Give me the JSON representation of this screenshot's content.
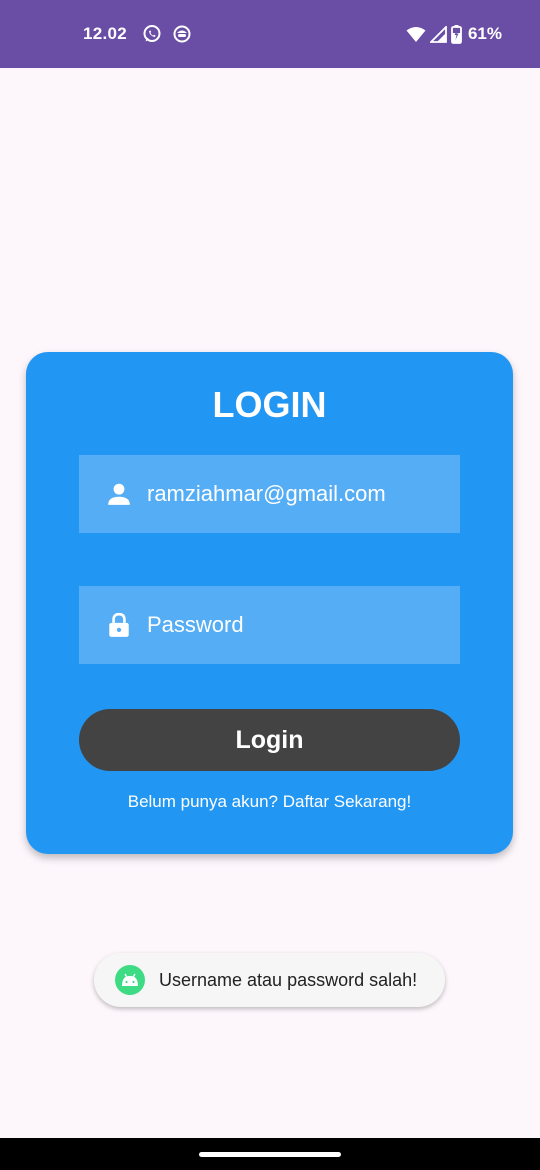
{
  "status_bar": {
    "time": "12.02",
    "icons_left": [
      "whatsapp-icon",
      "notification-app-icon"
    ],
    "icons_right": [
      "wifi-icon",
      "signal-icon",
      "battery-icon"
    ],
    "battery_percent": "61%",
    "background": "#6a4ea5"
  },
  "login_card": {
    "title": "LOGIN",
    "username": {
      "icon": "person-icon",
      "value": "ramziahmar@gmail.com"
    },
    "password": {
      "icon": "lock-icon",
      "placeholder": "Password",
      "value": ""
    },
    "login_button": "Login",
    "register_link": "Belum punya akun? Daftar Sekarang!",
    "background": "#2196f3",
    "field_background": "#55adf5",
    "button_background": "#434343"
  },
  "toast": {
    "icon": "android-icon",
    "message": "Username atau password salah!"
  }
}
